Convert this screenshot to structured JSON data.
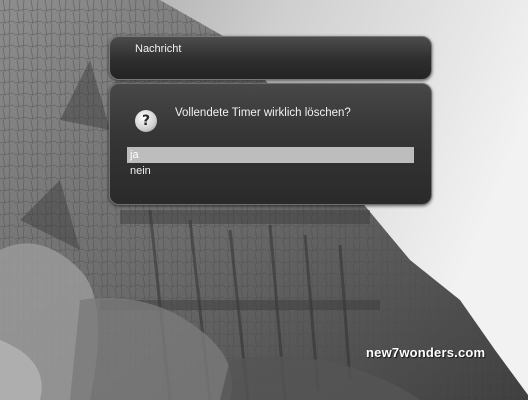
{
  "dialog": {
    "title": "Nachricht",
    "question": "Vollendete Timer wirklich löschen?",
    "icon": "question-icon",
    "choices": [
      "ja",
      "nein"
    ],
    "selected_choice": "ja"
  },
  "background": {
    "watermark": "new7wonders.com"
  }
}
